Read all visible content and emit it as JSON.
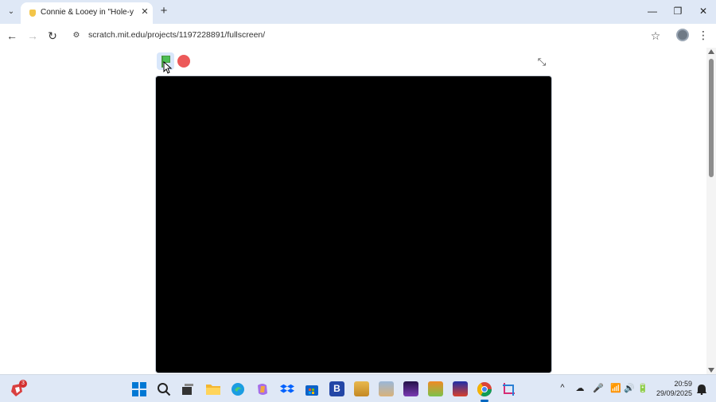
{
  "browser": {
    "tab": {
      "title": "Connie & Looey in \"Hole-y Mo",
      "close_glyph": "✕"
    },
    "tab_list_glyph": "⌄",
    "new_tab_glyph": "+",
    "window": {
      "minimize": "—",
      "restore": "❐",
      "close": "✕"
    },
    "nav": {
      "back": "←",
      "forward": "→",
      "reload": "↻",
      "site_info": "⚙"
    },
    "url": "scratch.mit.edu/projects/1197228891/fullscreen/",
    "bookmark_glyph": "☆",
    "menu_glyph": "⋮"
  },
  "scratch_player": {
    "exit_fullscreen_glyph": "⤡",
    "stage_color": "#000000",
    "flag_color": "#4cbf56",
    "stop_color": "#ec5959"
  },
  "taskbar": {
    "notification_count": "3",
    "pinned_icons": [
      "start-icon",
      "search-icon",
      "task-view-icon",
      "file-explorer-icon",
      "edge-icon",
      "copilot-icon",
      "dropbox-icon",
      "store-icon",
      "b-app-icon",
      "game-icon-1",
      "game-icon-2",
      "game-icon-3",
      "game-icon-4",
      "game-icon-5",
      "chrome-icon",
      "snipping-tool-icon"
    ],
    "b_app_label": "B",
    "tray": {
      "chevron": "^",
      "cloud": "☁",
      "mic": "🎤",
      "wifi": "📶",
      "volume": "🔊",
      "battery": "🔋"
    },
    "time": "20:59",
    "date": "29/09/2025"
  },
  "colors": {
    "chrome_frame": "#dfe8f6",
    "accent": "#0067c0"
  }
}
